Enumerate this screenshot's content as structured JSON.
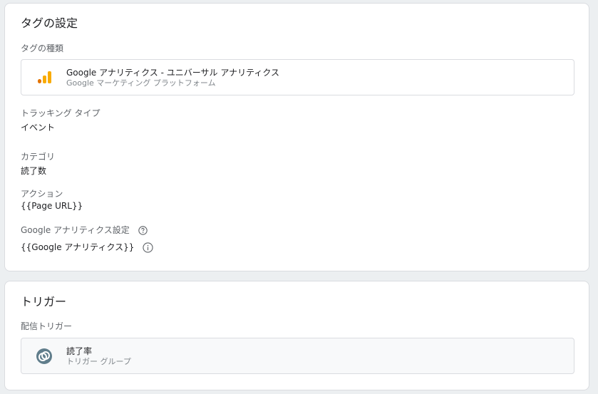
{
  "tag_section": {
    "title": "タグの設定",
    "tag_type_label": "タグの種類",
    "tag_type": {
      "name": "Google アナリティクス - ユニバーサル アナリティクス",
      "provider": "Google マーケティング プラットフォーム",
      "icon": "analytics-icon"
    },
    "tracking_type_label": "トラッキング タイプ",
    "tracking_type_value": "イベント",
    "category_label": "カテゴリ",
    "category_value": "読了数",
    "action_label": "アクション",
    "action_value": "{{Page URL}}",
    "settings_label": "Google アナリティクス設定",
    "settings_value": "{{Google アナリティクス}}"
  },
  "trigger_section": {
    "title": "トリガー",
    "firing_label": "配信トリガー",
    "trigger": {
      "name": "読了率",
      "type": "トリガー グループ",
      "icon": "trigger-group-icon"
    }
  },
  "colors": {
    "analytics_orange": "#f9ab00",
    "analytics_dark_orange": "#e37400",
    "trigger_icon": "#607d8b"
  }
}
